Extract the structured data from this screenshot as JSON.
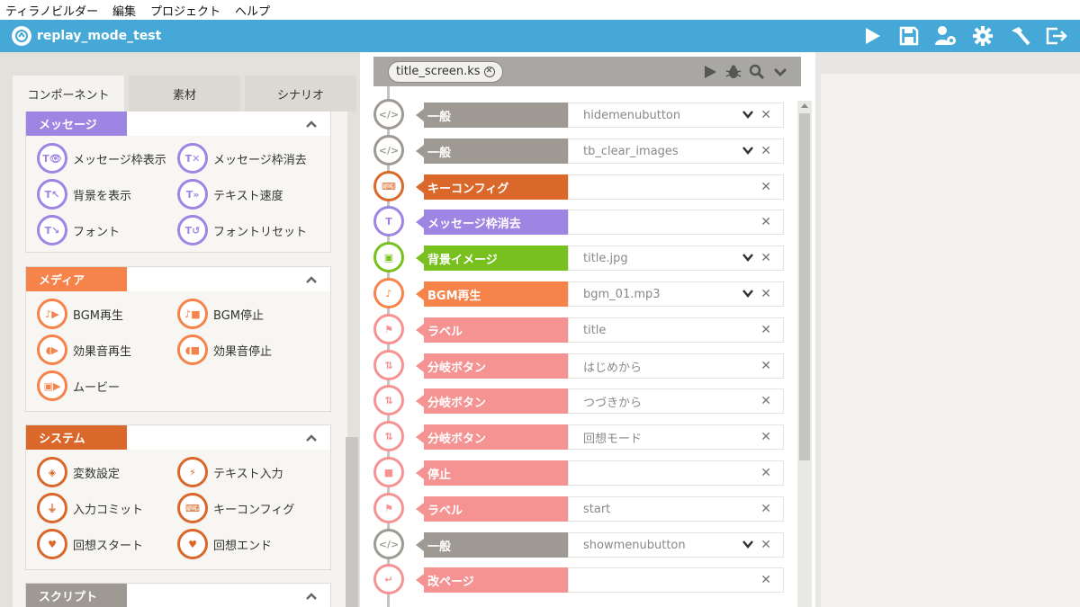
{
  "menu": [
    "ティラノビルダー",
    "編集",
    "プロジェクト",
    "ヘルプ"
  ],
  "app": {
    "project_title": "replay_mode_test"
  },
  "toolbar_icons": [
    "play-icon",
    "save-icon",
    "user-settings-icon",
    "gear-icon",
    "hammer-icon",
    "exit-icon"
  ],
  "left": {
    "tabs": [
      "コンポーネント",
      "素材",
      "シナリオ"
    ],
    "groups": [
      {
        "title": "メッセージ",
        "color": "#9f85e3",
        "items": [
          "メッセージ枠表示",
          "メッセージ枠消去",
          "背景を表示",
          "テキスト速度",
          "フォント",
          "フォントリセット"
        ]
      },
      {
        "title": "メディア",
        "color": "#f5834a",
        "items": [
          "BGM再生",
          "BGM停止",
          "効果音再生",
          "効果音停止",
          "ムービー"
        ]
      },
      {
        "title": "システム",
        "color": "#d9682a",
        "items": [
          "変数設定",
          "テキスト入力",
          "入力コミット",
          "キーコンフィグ",
          "回想スタート",
          "回想エンド"
        ]
      },
      {
        "title": "スクリプト",
        "color": "#9e9a93",
        "items": []
      }
    ]
  },
  "editor": {
    "file_name": "title_screen.ks",
    "rows": [
      {
        "label": "一般",
        "param": "hidemenubutton",
        "color": "#9e9a93",
        "dropdown": true,
        "icon": "code-icon",
        "glyph": "</>"
      },
      {
        "label": "一般",
        "param": "tb_clear_images",
        "color": "#9e9a93",
        "dropdown": true,
        "icon": "code-icon",
        "glyph": "</>"
      },
      {
        "label": "キーコンフィグ",
        "param": "",
        "color": "#d9682a",
        "dropdown": false,
        "icon": "keyboard-icon",
        "glyph": "⌨"
      },
      {
        "label": "メッセージ枠消去",
        "param": "",
        "color": "#9f85e3",
        "dropdown": false,
        "icon": "message-hide-icon",
        "glyph": "T"
      },
      {
        "label": "背景イメージ",
        "param": "title.jpg",
        "color": "#78c01e",
        "dropdown": true,
        "icon": "image-icon",
        "glyph": "▣"
      },
      {
        "label": "BGM再生",
        "param": "bgm_01.mp3",
        "color": "#f5834a",
        "dropdown": true,
        "icon": "music-play-icon",
        "glyph": "♪"
      },
      {
        "label": "ラベル",
        "param": "title",
        "color": "#f59393",
        "dropdown": false,
        "icon": "flag-icon",
        "glyph": "⚑"
      },
      {
        "label": "分岐ボタン",
        "param": "はじめから",
        "color": "#f59393",
        "dropdown": false,
        "icon": "branch-icon",
        "glyph": "⇅"
      },
      {
        "label": "分岐ボタン",
        "param": "つづきから",
        "color": "#f59393",
        "dropdown": false,
        "icon": "branch-icon",
        "glyph": "⇅"
      },
      {
        "label": "分岐ボタン",
        "param": "回想モード",
        "color": "#f59393",
        "dropdown": false,
        "icon": "branch-icon",
        "glyph": "⇅"
      },
      {
        "label": "停止",
        "param": "",
        "color": "#f59393",
        "dropdown": false,
        "icon": "stop-icon",
        "glyph": "■"
      },
      {
        "label": "ラベル",
        "param": "start",
        "color": "#f59393",
        "dropdown": false,
        "icon": "flag-icon",
        "glyph": "⚑"
      },
      {
        "label": "一般",
        "param": "showmenubutton",
        "color": "#9e9a93",
        "dropdown": true,
        "icon": "code-icon",
        "glyph": "</>"
      },
      {
        "label": "改ページ",
        "param": "",
        "color": "#f59393",
        "dropdown": false,
        "icon": "page-break-icon",
        "glyph": "↵"
      }
    ]
  }
}
